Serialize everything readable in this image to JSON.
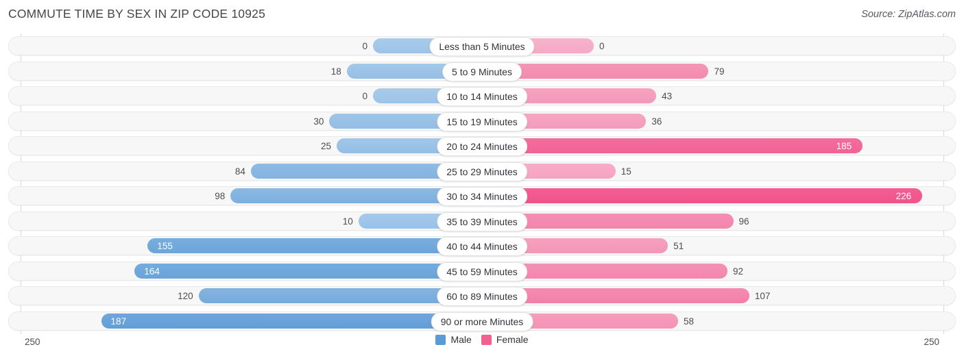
{
  "title": "COMMUTE TIME BY SEX IN ZIP CODE 10925",
  "source": "Source: ZipAtlas.com",
  "axis": {
    "left_max_label": "250",
    "right_max_label": "250"
  },
  "legend": [
    {
      "label": "Male",
      "color": "#5b9bd5"
    },
    {
      "label": "Female",
      "color": "#f2608f"
    }
  ],
  "colors": {
    "male_light": "#8cb8e2",
    "male_dark": "#5b9bd5",
    "female_light": "#f4a3c0",
    "female_dark": "#f2568c",
    "track": "#f7f7f7",
    "axis": "#d8d8d8"
  },
  "chart_data": {
    "type": "bar",
    "title": "COMMUTE TIME BY SEX IN ZIP CODE 10925",
    "orientation": "horizontal-diverging",
    "xlabel": "",
    "ylabel": "",
    "xlim": [
      250,
      250
    ],
    "grid": false,
    "legend_position": "bottom-center",
    "categories": [
      "Less than 5 Minutes",
      "5 to 9 Minutes",
      "10 to 14 Minutes",
      "15 to 19 Minutes",
      "20 to 24 Minutes",
      "25 to 29 Minutes",
      "30 to 34 Minutes",
      "35 to 39 Minutes",
      "40 to 44 Minutes",
      "45 to 59 Minutes",
      "60 to 89 Minutes",
      "90 or more Minutes"
    ],
    "series": [
      {
        "name": "Male",
        "values": [
          0,
          18,
          0,
          30,
          25,
          84,
          98,
          10,
          155,
          164,
          120,
          187
        ]
      },
      {
        "name": "Female",
        "values": [
          0,
          79,
          43,
          36,
          185,
          15,
          226,
          96,
          51,
          92,
          107,
          58
        ]
      }
    ]
  }
}
